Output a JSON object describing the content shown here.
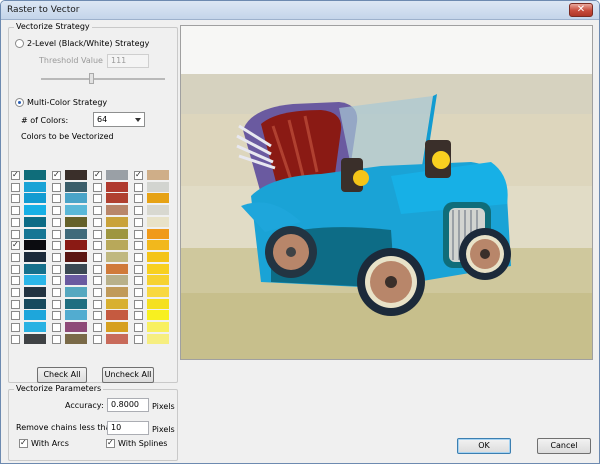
{
  "window": {
    "title": "Raster to Vector",
    "close_glyph": "✕"
  },
  "strategy": {
    "legend": "Vectorize Strategy",
    "two_level": {
      "label": "2-Level (Black/White) Strategy",
      "selected": false
    },
    "threshold": {
      "label": "Threshold Value",
      "value": "111"
    },
    "multi_color": {
      "label": "Multi-Color Strategy",
      "selected": true
    },
    "num_colors": {
      "label": "# of Colors:",
      "value": "64"
    },
    "colors_label": "Colors to be Vectorized"
  },
  "palette": {
    "columns": [
      [
        {
          "color": "#0f6d7a",
          "checked": true
        },
        {
          "color": "#1aa3d6",
          "checked": false
        },
        {
          "color": "#129bd1",
          "checked": false
        },
        {
          "color": "#17b0e6",
          "checked": false
        },
        {
          "color": "#0d6c86",
          "checked": false
        },
        {
          "color": "#167694",
          "checked": false
        },
        {
          "color": "#0b0c10",
          "checked": true
        },
        {
          "color": "#1c2a3a",
          "checked": false
        },
        {
          "color": "#16708c",
          "checked": false
        },
        {
          "color": "#2bb6e8",
          "checked": false
        },
        {
          "color": "#233442",
          "checked": false
        },
        {
          "color": "#174a5e",
          "checked": false
        },
        {
          "color": "#1ea6db",
          "checked": false
        },
        {
          "color": "#29b2e3",
          "checked": false
        },
        {
          "color": "#3f4245",
          "checked": false
        }
      ],
      [
        {
          "color": "#3a2f2a",
          "checked": true
        },
        {
          "color": "#3b5e6a",
          "checked": false
        },
        {
          "color": "#4aa4c8",
          "checked": false
        },
        {
          "color": "#5ab8d8",
          "checked": false
        },
        {
          "color": "#65612a",
          "checked": false
        },
        {
          "color": "#3f6a7a",
          "checked": false
        },
        {
          "color": "#8a1a14",
          "checked": false
        },
        {
          "color": "#5a1612",
          "checked": false
        },
        {
          "color": "#3a4852",
          "checked": false
        },
        {
          "color": "#6a5aa0",
          "checked": false
        },
        {
          "color": "#55a8c0",
          "checked": false
        },
        {
          "color": "#1f6e80",
          "checked": false
        },
        {
          "color": "#52acd0",
          "checked": false
        },
        {
          "color": "#8e4a78",
          "checked": false
        },
        {
          "color": "#7a6a48",
          "checked": false
        }
      ],
      [
        {
          "color": "#9aa0a6",
          "checked": true
        },
        {
          "color": "#b03a2e",
          "checked": false
        },
        {
          "color": "#b04030",
          "checked": false
        },
        {
          "color": "#b8866a",
          "checked": false
        },
        {
          "color": "#c9a23a",
          "checked": false
        },
        {
          "color": "#9e9640",
          "checked": false
        },
        {
          "color": "#b8a85a",
          "checked": false
        },
        {
          "color": "#c0b880",
          "checked": false
        },
        {
          "color": "#d07a3a",
          "checked": false
        },
        {
          "color": "#b8b08a",
          "checked": false
        },
        {
          "color": "#c09a5a",
          "checked": false
        },
        {
          "color": "#d8b030",
          "checked": false
        },
        {
          "color": "#c55a40",
          "checked": false
        },
        {
          "color": "#d6a020",
          "checked": false
        },
        {
          "color": "#c86a5a",
          "checked": false
        }
      ],
      [
        {
          "color": "#cfae88",
          "checked": true
        },
        {
          "color": "#d2d4d0",
          "checked": false
        },
        {
          "color": "#e6a214",
          "checked": false
        },
        {
          "color": "#d8d8d0",
          "checked": false
        },
        {
          "color": "#e8e2c8",
          "checked": false
        },
        {
          "color": "#f09a1a",
          "checked": false
        },
        {
          "color": "#f2b81c",
          "checked": false
        },
        {
          "color": "#f4c418",
          "checked": false
        },
        {
          "color": "#f8d020",
          "checked": false
        },
        {
          "color": "#f6d230",
          "checked": false
        },
        {
          "color": "#f8d840",
          "checked": false
        },
        {
          "color": "#f5e020",
          "checked": false
        },
        {
          "color": "#f8f020",
          "checked": false
        },
        {
          "color": "#f8f060",
          "checked": false
        },
        {
          "color": "#f6ee80",
          "checked": false
        }
      ]
    ]
  },
  "buttons": {
    "check_all": "Check All",
    "uncheck_all": "Uncheck All",
    "ok": "OK",
    "cancel": "Cancel"
  },
  "params": {
    "legend": "Vectorize Parameters",
    "accuracy": {
      "label": "Accuracy:",
      "value": "0.8000",
      "unit": "Pixels"
    },
    "remove_chains": {
      "label": "Remove chains less than",
      "value": "10",
      "unit": "Pixels"
    },
    "with_arcs": {
      "label": "With Arcs",
      "checked": true
    },
    "with_splines": {
      "label": "With Splines",
      "checked": true
    }
  },
  "colors": {
    "car_body": "#1aa3d6",
    "car_dark": "#0d6c86",
    "seat_red": "#8a1a14",
    "roof_purple": "#6a5aa0",
    "lamp_yellow": "#f4c418",
    "wood_spokes": "#b8866a"
  }
}
